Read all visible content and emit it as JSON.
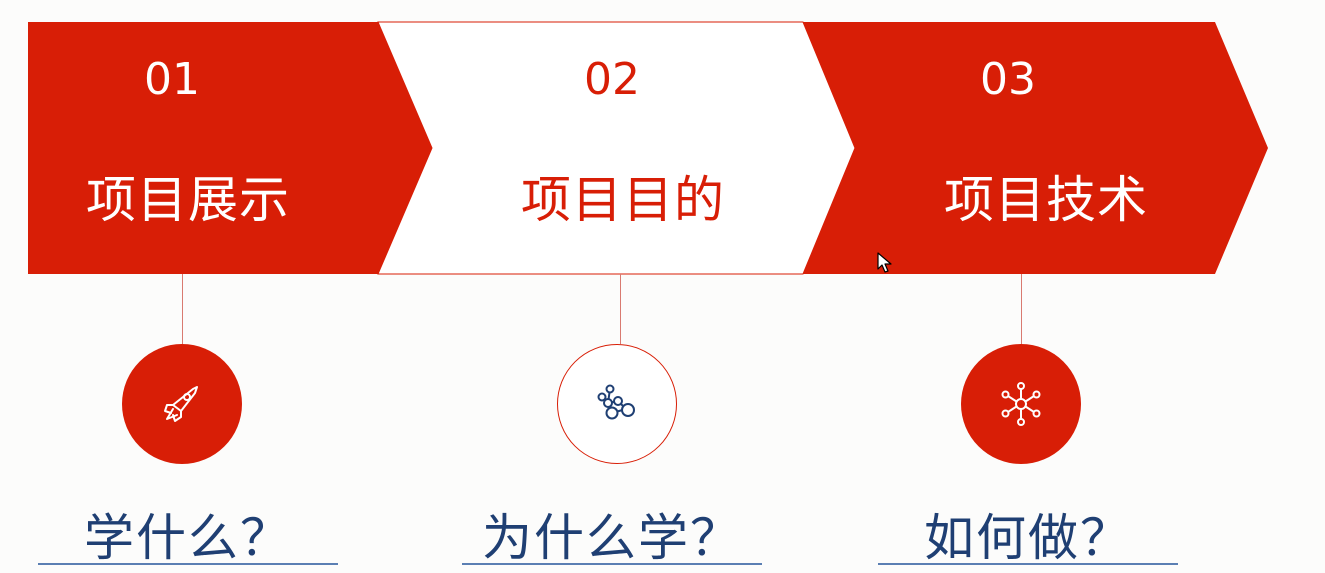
{
  "steps": [
    {
      "number": "01",
      "title": "项目展示",
      "question": "学什么？",
      "icon": "rocket-icon"
    },
    {
      "number": "02",
      "title": "项目目的",
      "question": "为什么学？",
      "icon": "molecule-icon"
    },
    {
      "number": "03",
      "title": "项目技术",
      "question": "如何做？",
      "icon": "network-hub-icon"
    }
  ],
  "colors": {
    "accent": "#d81e06",
    "question_text": "#1f3f73",
    "underline": "#5b7fb3"
  }
}
